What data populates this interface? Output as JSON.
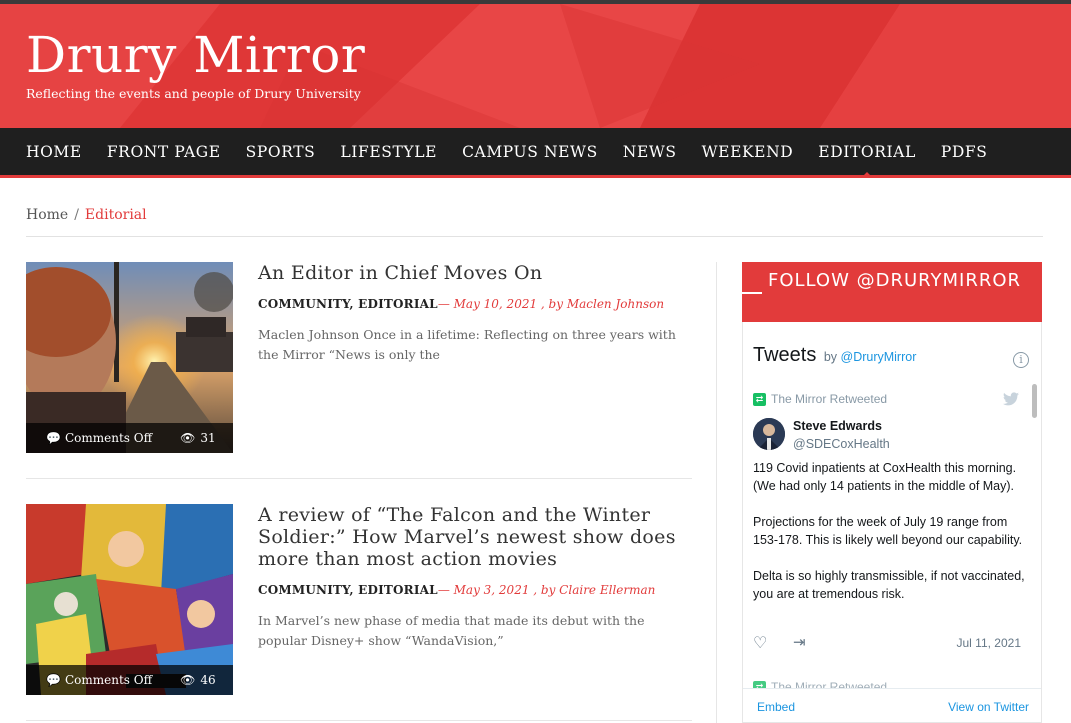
{
  "header": {
    "site_title": "Drury Mirror",
    "tagline": "Reflecting the events and people of Drury University",
    "accent_color": "#e23b3b"
  },
  "nav": {
    "items": [
      "HOME",
      "FRONT PAGE",
      "SPORTS",
      "LIFESTYLE",
      "CAMPUS NEWS",
      "NEWS",
      "WEEKEND",
      "EDITORIAL",
      "PDFS"
    ],
    "active": "EDITORIAL"
  },
  "breadcrumb": {
    "home": "Home",
    "separator": "/",
    "current": "Editorial"
  },
  "posts": [
    {
      "title": "An Editor in Chief Moves On",
      "categories": "COMMUNITY, EDITORIAL",
      "date_author": "— May 10, 2021 , by Maclen Johnson",
      "excerpt": "Maclen Johnson Once in a lifetime: Reflecting on three years with the Mirror “News is only the",
      "comments": "Comments Off",
      "views": "31",
      "image": "photo-portrait-sunset"
    },
    {
      "title": "A review of “The Falcon and the Winter Soldier:” How Marvel’s newest show does more than most action movies",
      "categories": "COMMUNITY, EDITORIAL",
      "date_author": "— May 3, 2021 , by Claire Ellerman",
      "excerpt": "In Marvel’s new phase of media that made its debut with the popular Disney+ show “WandaVision,”",
      "comments": "Comments Off",
      "views": "46",
      "image": "photo-comic-books"
    }
  ],
  "sidebar": {
    "follow_title": "FOLLOW @DRURYMIRROR",
    "twitter": {
      "heading": "Tweets",
      "by_prefix": "by",
      "by_handle": "@DruryMirror",
      "retweet_label": "The Mirror Retweeted",
      "author_name": "Steve Edwards",
      "author_handle": "@SDECoxHealth",
      "tweet_paragraphs": [
        "119 Covid inpatients at CoxHealth this morning. (We had only 14 patients in the middle of May).",
        "Projections for the week of July 19 range from 153-178. This is likely well beyond our capability.",
        "Delta is so highly transmissible, if not vaccinated, you are at tremendous risk."
      ],
      "tweet_date": "Jul 11, 2021",
      "next_retweet_label": "The Mirror Retweeted",
      "embed_label": "Embed",
      "view_label": "View on Twitter"
    }
  }
}
